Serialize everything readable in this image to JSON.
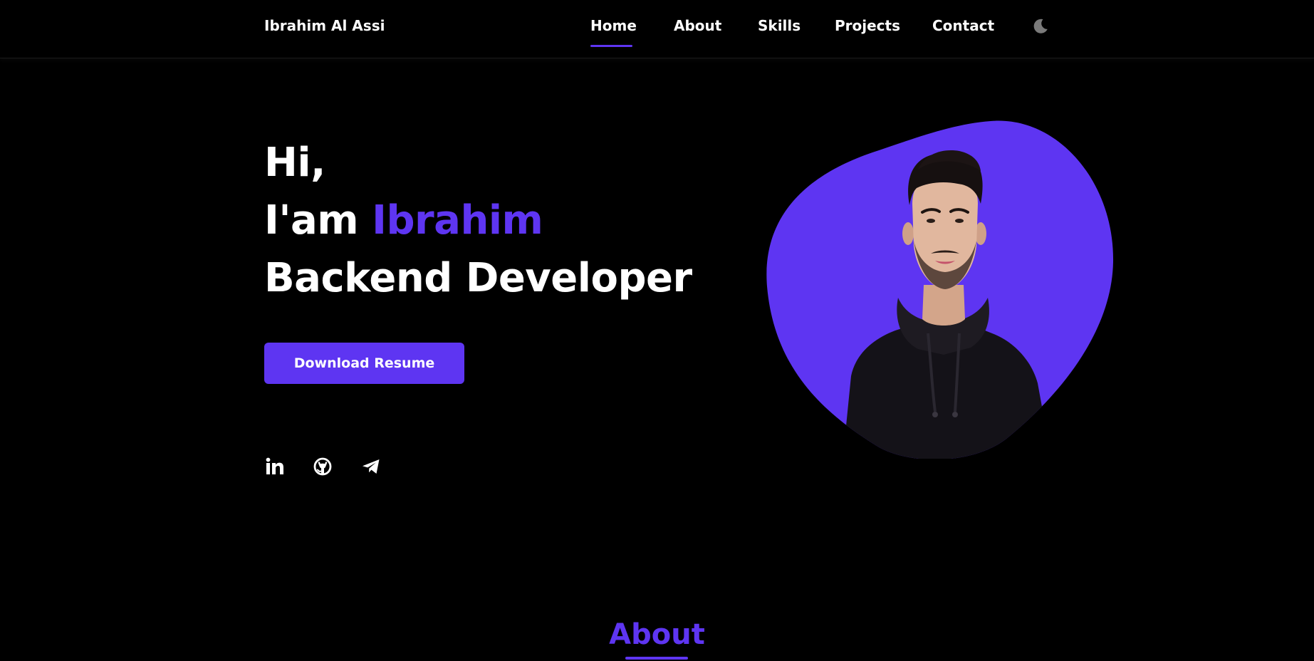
{
  "brand": {
    "name": "Ibrahim Al Assi"
  },
  "nav": {
    "items": [
      {
        "label": "Home",
        "active": true
      },
      {
        "label": "About",
        "active": false
      },
      {
        "label": "Skills",
        "active": false
      },
      {
        "label": "Projects",
        "active": false
      },
      {
        "label": "Contact",
        "active": false
      }
    ],
    "theme_toggle_icon": "moon-icon"
  },
  "hero": {
    "greeting": "Hi,",
    "intro_prefix": "I'am",
    "name": "Ibrahim",
    "role": "Backend Developer",
    "button_label": "Download Resume",
    "socials": [
      {
        "icon": "linkedin-icon"
      },
      {
        "icon": "github-icon"
      },
      {
        "icon": "telegram-icon"
      }
    ],
    "photo": "profile-photo"
  },
  "about": {
    "title": "About"
  },
  "colors": {
    "background": "#000000",
    "accent": "#5e35f2",
    "text": "#ffffff",
    "toggle": "#7a7a7a"
  }
}
